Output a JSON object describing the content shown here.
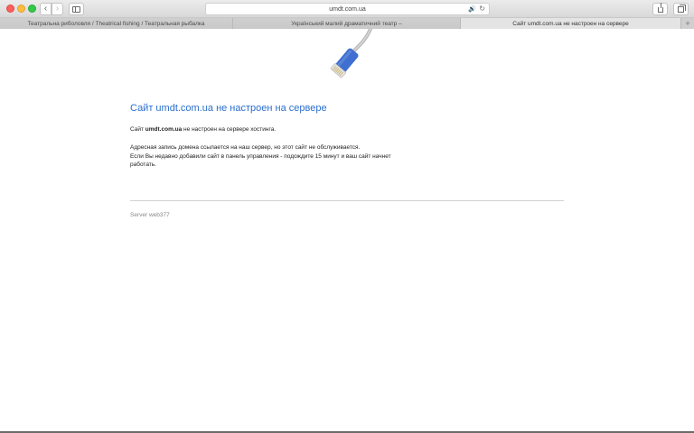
{
  "browser": {
    "address": "umdt.com.ua",
    "icons": {
      "back": "chevron-left-icon",
      "forward": "chevron-right-icon",
      "sidebar": "sidebar-icon",
      "audio": "speaker-icon",
      "reload": "reload-icon",
      "share": "share-icon",
      "tabs": "tabs-overview-icon",
      "add_tab": "plus-icon"
    },
    "back_glyph": "‹",
    "forward_glyph": "›",
    "speaker_glyph": "🔊",
    "reload_glyph": "↻",
    "add_tab_glyph": "+"
  },
  "tabs": [
    {
      "label": "Театральна риболовля / Theatrical fishing / Театральная рыбалка"
    },
    {
      "label": "Український малий драматичний театр –"
    },
    {
      "label": "Сайт umdt.com.ua не настроен на сервере"
    }
  ],
  "page": {
    "title": "Сайт umdt.com.ua не настроен на сервере",
    "line1_prefix": "Сайт ",
    "line1_domain": "umdt.com.ua",
    "line1_suffix": " не настроен на сервере хостинга.",
    "para_line1": "Адресная запись домена ссылается на наш сервер, но этот сайт не обслуживается.",
    "para_line2": "Если Вы недавно добавили сайт в панель управления - подождите 15 минут и ваш сайт начнет работать.",
    "server": "Server web377"
  },
  "colors": {
    "title": "#2a6fcf",
    "cable": "#3f6fd0",
    "divider": "#d2d2d2"
  }
}
